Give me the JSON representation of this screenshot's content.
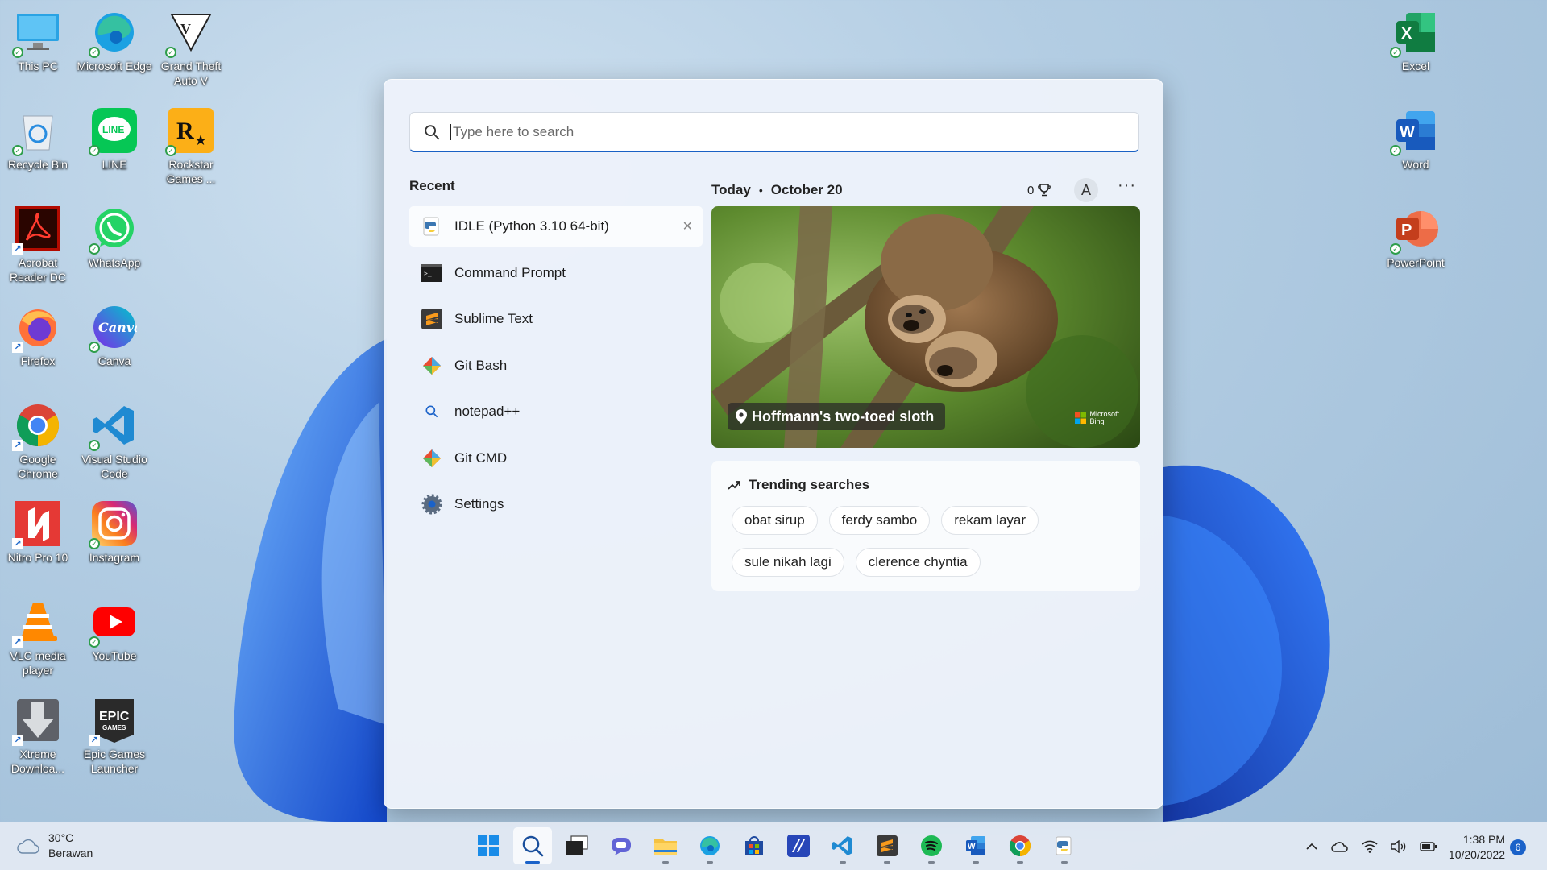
{
  "desktop": {
    "left_icons": [
      {
        "label": "This PC",
        "icon": "this-pc-icon"
      },
      {
        "label": "Microsoft Edge",
        "icon": "edge-icon"
      },
      {
        "label": "Grand Theft Auto V",
        "icon": "gta-v-icon"
      },
      {
        "label": "Recycle Bin",
        "icon": "recycle-bin-icon"
      },
      {
        "label": "LINE",
        "icon": "line-icon"
      },
      {
        "label": "Rockstar Games ...",
        "icon": "rockstar-icon"
      },
      {
        "label": "Acrobat Reader DC",
        "icon": "acrobat-icon"
      },
      {
        "label": "WhatsApp",
        "icon": "whatsapp-icon"
      },
      {
        "label": "Firefox",
        "icon": "firefox-icon"
      },
      {
        "label": "Canva",
        "icon": "canva-icon"
      },
      {
        "label": "Google Chrome",
        "icon": "chrome-icon"
      },
      {
        "label": "Visual Studio Code",
        "icon": "vscode-icon"
      },
      {
        "label": "Nitro Pro 10",
        "icon": "nitro-icon"
      },
      {
        "label": "Instagram",
        "icon": "instagram-icon"
      },
      {
        "label": "VLC media player",
        "icon": "vlc-icon"
      },
      {
        "label": "YouTube",
        "icon": "youtube-icon"
      },
      {
        "label": "Xtreme Downloa...",
        "icon": "xtreme-download-icon"
      },
      {
        "label": "Epic Games Launcher",
        "icon": "epic-games-icon"
      }
    ],
    "right_icons": [
      {
        "label": "Excel",
        "icon": "excel-icon"
      },
      {
        "label": "Word",
        "icon": "word-icon"
      },
      {
        "label": "PowerPoint",
        "icon": "powerpoint-icon"
      }
    ]
  },
  "search": {
    "placeholder": "Type here to search",
    "value": ""
  },
  "recent": {
    "heading": "Recent",
    "items": [
      {
        "label": "IDLE (Python 3.10 64-bit)",
        "icon": "python-idle-icon"
      },
      {
        "label": "Command Prompt",
        "icon": "cmd-icon"
      },
      {
        "label": "Sublime Text",
        "icon": "sublime-icon"
      },
      {
        "label": "Git Bash",
        "icon": "git-icon"
      },
      {
        "label": "notepad++",
        "icon": "search-icon"
      },
      {
        "label": "Git CMD",
        "icon": "git-icon"
      },
      {
        "label": "Settings",
        "icon": "settings-gear-icon"
      }
    ],
    "close_glyph": "✕"
  },
  "today": {
    "label": "Today",
    "separator": "•",
    "date": "October 20",
    "points": "0",
    "avatar_initial": "A",
    "more_glyph": "···"
  },
  "hero": {
    "caption": "Hoffmann's two-toed sloth",
    "brand_line1": "Microsoft",
    "brand_line2": "Bing"
  },
  "trending": {
    "heading": "Trending searches",
    "chips": [
      "obat sirup",
      "ferdy sambo",
      "rekam layar",
      "sule nikah lagi",
      "clerence chyntia"
    ]
  },
  "taskbar": {
    "weather_temp": "30°C",
    "weather_desc": "Berawan",
    "apps": [
      "windows-start-icon",
      "search-icon",
      "task-view-icon",
      "teams-chat-icon",
      "file-explorer-icon",
      "edge-icon",
      "microsoft-store-icon",
      "app-icon",
      "vscode-icon",
      "sublime-icon",
      "spotify-icon",
      "word-icon",
      "chrome-icon",
      "python-idle-icon"
    ],
    "time": "1:38 PM",
    "date": "10/20/2022",
    "notification_count": "6"
  },
  "colors": {
    "accent": "#1961c4",
    "panel_bg": "#ecf2fa"
  }
}
